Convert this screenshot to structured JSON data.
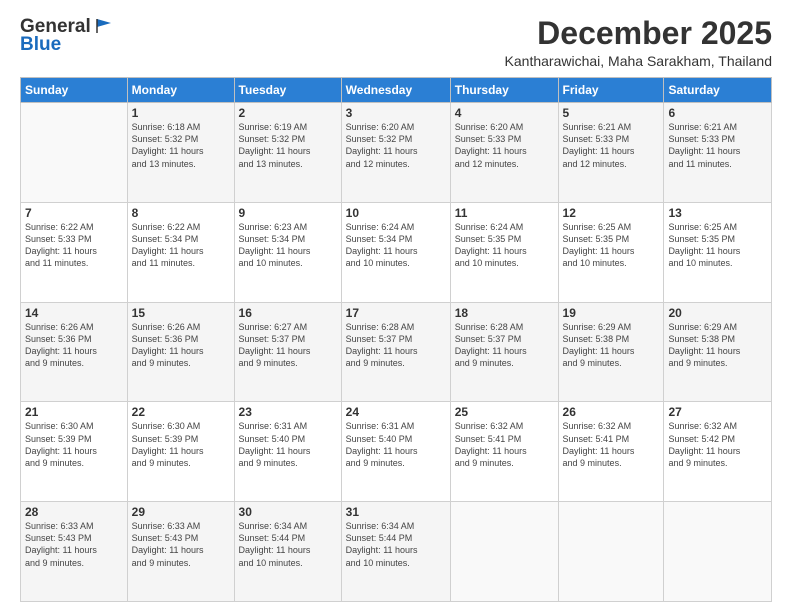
{
  "header": {
    "logo_general": "General",
    "logo_blue": "Blue",
    "month_title": "December 2025",
    "location": "Kantharawichai, Maha Sarakham, Thailand"
  },
  "days_of_week": [
    "Sunday",
    "Monday",
    "Tuesday",
    "Wednesday",
    "Thursday",
    "Friday",
    "Saturday"
  ],
  "weeks": [
    [
      {
        "day": "",
        "sunrise": "",
        "sunset": "",
        "daylight": ""
      },
      {
        "day": "1",
        "sunrise": "Sunrise: 6:18 AM",
        "sunset": "Sunset: 5:32 PM",
        "daylight": "Daylight: 11 hours and 13 minutes."
      },
      {
        "day": "2",
        "sunrise": "Sunrise: 6:19 AM",
        "sunset": "Sunset: 5:32 PM",
        "daylight": "Daylight: 11 hours and 13 minutes."
      },
      {
        "day": "3",
        "sunrise": "Sunrise: 6:20 AM",
        "sunset": "Sunset: 5:32 PM",
        "daylight": "Daylight: 11 hours and 12 minutes."
      },
      {
        "day": "4",
        "sunrise": "Sunrise: 6:20 AM",
        "sunset": "Sunset: 5:33 PM",
        "daylight": "Daylight: 11 hours and 12 minutes."
      },
      {
        "day": "5",
        "sunrise": "Sunrise: 6:21 AM",
        "sunset": "Sunset: 5:33 PM",
        "daylight": "Daylight: 11 hours and 12 minutes."
      },
      {
        "day": "6",
        "sunrise": "Sunrise: 6:21 AM",
        "sunset": "Sunset: 5:33 PM",
        "daylight": "Daylight: 11 hours and 11 minutes."
      }
    ],
    [
      {
        "day": "7",
        "sunrise": "Sunrise: 6:22 AM",
        "sunset": "Sunset: 5:33 PM",
        "daylight": "Daylight: 11 hours and 11 minutes."
      },
      {
        "day": "8",
        "sunrise": "Sunrise: 6:22 AM",
        "sunset": "Sunset: 5:34 PM",
        "daylight": "Daylight: 11 hours and 11 minutes."
      },
      {
        "day": "9",
        "sunrise": "Sunrise: 6:23 AM",
        "sunset": "Sunset: 5:34 PM",
        "daylight": "Daylight: 11 hours and 10 minutes."
      },
      {
        "day": "10",
        "sunrise": "Sunrise: 6:24 AM",
        "sunset": "Sunset: 5:34 PM",
        "daylight": "Daylight: 11 hours and 10 minutes."
      },
      {
        "day": "11",
        "sunrise": "Sunrise: 6:24 AM",
        "sunset": "Sunset: 5:35 PM",
        "daylight": "Daylight: 11 hours and 10 minutes."
      },
      {
        "day": "12",
        "sunrise": "Sunrise: 6:25 AM",
        "sunset": "Sunset: 5:35 PM",
        "daylight": "Daylight: 11 hours and 10 minutes."
      },
      {
        "day": "13",
        "sunrise": "Sunrise: 6:25 AM",
        "sunset": "Sunset: 5:35 PM",
        "daylight": "Daylight: 11 hours and 10 minutes."
      }
    ],
    [
      {
        "day": "14",
        "sunrise": "Sunrise: 6:26 AM",
        "sunset": "Sunset: 5:36 PM",
        "daylight": "Daylight: 11 hours and 9 minutes."
      },
      {
        "day": "15",
        "sunrise": "Sunrise: 6:26 AM",
        "sunset": "Sunset: 5:36 PM",
        "daylight": "Daylight: 11 hours and 9 minutes."
      },
      {
        "day": "16",
        "sunrise": "Sunrise: 6:27 AM",
        "sunset": "Sunset: 5:37 PM",
        "daylight": "Daylight: 11 hours and 9 minutes."
      },
      {
        "day": "17",
        "sunrise": "Sunrise: 6:28 AM",
        "sunset": "Sunset: 5:37 PM",
        "daylight": "Daylight: 11 hours and 9 minutes."
      },
      {
        "day": "18",
        "sunrise": "Sunrise: 6:28 AM",
        "sunset": "Sunset: 5:37 PM",
        "daylight": "Daylight: 11 hours and 9 minutes."
      },
      {
        "day": "19",
        "sunrise": "Sunrise: 6:29 AM",
        "sunset": "Sunset: 5:38 PM",
        "daylight": "Daylight: 11 hours and 9 minutes."
      },
      {
        "day": "20",
        "sunrise": "Sunrise: 6:29 AM",
        "sunset": "Sunset: 5:38 PM",
        "daylight": "Daylight: 11 hours and 9 minutes."
      }
    ],
    [
      {
        "day": "21",
        "sunrise": "Sunrise: 6:30 AM",
        "sunset": "Sunset: 5:39 PM",
        "daylight": "Daylight: 11 hours and 9 minutes."
      },
      {
        "day": "22",
        "sunrise": "Sunrise: 6:30 AM",
        "sunset": "Sunset: 5:39 PM",
        "daylight": "Daylight: 11 hours and 9 minutes."
      },
      {
        "day": "23",
        "sunrise": "Sunrise: 6:31 AM",
        "sunset": "Sunset: 5:40 PM",
        "daylight": "Daylight: 11 hours and 9 minutes."
      },
      {
        "day": "24",
        "sunrise": "Sunrise: 6:31 AM",
        "sunset": "Sunset: 5:40 PM",
        "daylight": "Daylight: 11 hours and 9 minutes."
      },
      {
        "day": "25",
        "sunrise": "Sunrise: 6:32 AM",
        "sunset": "Sunset: 5:41 PM",
        "daylight": "Daylight: 11 hours and 9 minutes."
      },
      {
        "day": "26",
        "sunrise": "Sunrise: 6:32 AM",
        "sunset": "Sunset: 5:41 PM",
        "daylight": "Daylight: 11 hours and 9 minutes."
      },
      {
        "day": "27",
        "sunrise": "Sunrise: 6:32 AM",
        "sunset": "Sunset: 5:42 PM",
        "daylight": "Daylight: 11 hours and 9 minutes."
      }
    ],
    [
      {
        "day": "28",
        "sunrise": "Sunrise: 6:33 AM",
        "sunset": "Sunset: 5:43 PM",
        "daylight": "Daylight: 11 hours and 9 minutes."
      },
      {
        "day": "29",
        "sunrise": "Sunrise: 6:33 AM",
        "sunset": "Sunset: 5:43 PM",
        "daylight": "Daylight: 11 hours and 9 minutes."
      },
      {
        "day": "30",
        "sunrise": "Sunrise: 6:34 AM",
        "sunset": "Sunset: 5:44 PM",
        "daylight": "Daylight: 11 hours and 10 minutes."
      },
      {
        "day": "31",
        "sunrise": "Sunrise: 6:34 AM",
        "sunset": "Sunset: 5:44 PM",
        "daylight": "Daylight: 11 hours and 10 minutes."
      },
      {
        "day": "",
        "sunrise": "",
        "sunset": "",
        "daylight": ""
      },
      {
        "day": "",
        "sunrise": "",
        "sunset": "",
        "daylight": ""
      },
      {
        "day": "",
        "sunrise": "",
        "sunset": "",
        "daylight": ""
      }
    ]
  ]
}
